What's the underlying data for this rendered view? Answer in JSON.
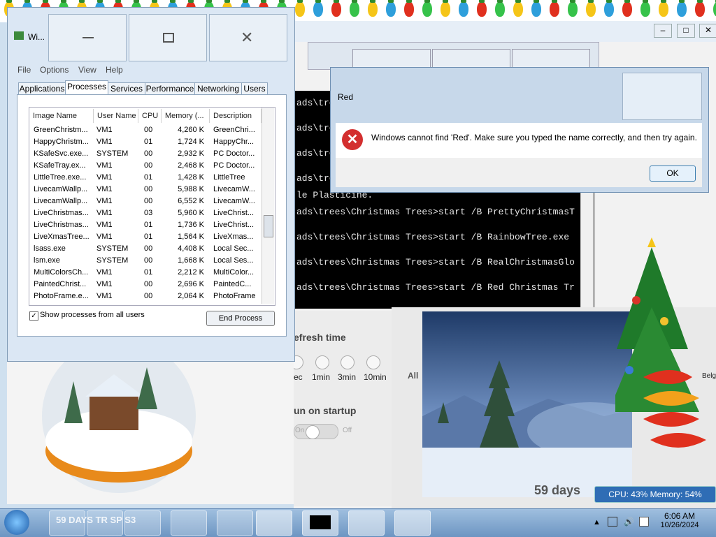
{
  "taskmanager": {
    "title": "Wi...",
    "menu": [
      "File",
      "Options",
      "View",
      "Help"
    ],
    "tabs": [
      "Applications",
      "Processes",
      "Services",
      "Performance",
      "Networking",
      "Users"
    ],
    "columns": [
      "Image Name",
      "User Name",
      "CPU",
      "Memory (...",
      "Description"
    ],
    "rows": [
      [
        "GreenChristm...",
        "VM1",
        "00",
        "4,260 K",
        "GreenChri..."
      ],
      [
        "HappyChristm...",
        "VM1",
        "01",
        "1,724 K",
        "HappyChr..."
      ],
      [
        "KSafeSvc.exe...",
        "SYSTEM",
        "00",
        "2,932 K",
        "PC Doctor..."
      ],
      [
        "KSafeTray.ex...",
        "VM1",
        "00",
        "2,468 K",
        "PC Doctor..."
      ],
      [
        "LittleTree.exe...",
        "VM1",
        "01",
        "1,428 K",
        "LittleTree"
      ],
      [
        "LivecamWallp...",
        "VM1",
        "00",
        "5,988 K",
        "LivecamW..."
      ],
      [
        "LivecamWallp...",
        "VM1",
        "00",
        "6,552 K",
        "LivecamW..."
      ],
      [
        "LiveChristmas...",
        "VM1",
        "03",
        "5,960 K",
        "LiveChrist..."
      ],
      [
        "LiveChristmas...",
        "VM1",
        "01",
        "1,736 K",
        "LiveChrist..."
      ],
      [
        "LiveXmasTree...",
        "VM1",
        "01",
        "1,564 K",
        "LiveXmas..."
      ],
      [
        "lsass.exe",
        "SYSTEM",
        "00",
        "4,408 K",
        "Local Sec..."
      ],
      [
        "lsm.exe",
        "SYSTEM",
        "00",
        "1,668 K",
        "Local Ses..."
      ],
      [
        "MultiColorsCh...",
        "VM1",
        "01",
        "2,212 K",
        "MultiColor..."
      ],
      [
        "PaintedChrist...",
        "VM1",
        "00",
        "2,696 K",
        "PaintedC..."
      ],
      [
        "PhotoFrame.e...",
        "VM1",
        "00",
        "2,064 K",
        "PhotoFrame"
      ]
    ],
    "show_all_label": "Show processes from all users",
    "end_process_label": "End Process"
  },
  "dialog": {
    "title": "Red",
    "message": "Windows cannot find 'Red'. Make sure you typed the name correctly, and then try again.",
    "ok_label": "OK"
  },
  "console": {
    "lines": [
      "ads\\tre",
      "ads\\tre",
      "ads\\tre",
      "ads\\tre",
      "le Plasticine.",
      "ads\\trees\\Christmas Trees>start /B PrettyChristmasT",
      "ads\\trees\\Christmas Trees>start /B RainbowTree.exe",
      "ads\\trees\\Christmas Trees>start /B RealChristmasGlo",
      "ads\\trees\\Christmas Trees>start /B Red Christmas Tr"
    ]
  },
  "settings": {
    "refresh_title": "efresh time",
    "options": [
      "ec",
      "1min",
      "3min",
      "10min"
    ],
    "startup_title": "un on startup",
    "on_label": "On",
    "off_label": "Off",
    "all_label": "All",
    "right_partial": "Belg"
  },
  "widgets": {
    "globe_counter": "59 days",
    "cpu_memory": "CPU: 43%  Memory: 54%"
  },
  "taskbar": {
    "time": "6:06 AM",
    "date": "10/26/2024",
    "overlay_text": "59 DAYS TR SP S3"
  },
  "colors": {
    "accent": "#2f6db5",
    "error": "#d32f2f",
    "console_bg": "#000000"
  }
}
